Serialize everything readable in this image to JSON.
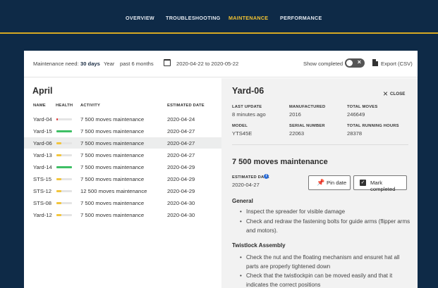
{
  "nav": {
    "tabs": [
      {
        "label": "OVERVIEW",
        "active": false
      },
      {
        "label": "TROUBLESHOOTING",
        "active": false
      },
      {
        "label": "MAINTENANCE",
        "active": true
      },
      {
        "label": "PERFORMANCE",
        "active": false
      }
    ]
  },
  "filter": {
    "need_label": "Maintenance need:",
    "days": "30 days",
    "year": "Year",
    "past": "past 6 months",
    "date_range": "2020-04-22 to 2020-05-22",
    "show_completed": "Show completed",
    "show_completed_on": false,
    "export": "Export (CSV)"
  },
  "list": {
    "month": "April",
    "columns": [
      "NAME",
      "HEALTH",
      "ACTIVITY",
      "ESTIMATED DATE"
    ],
    "rows": [
      {
        "name": "Yard-04",
        "health": 0.08,
        "health_color": "#e03131",
        "activity": "7 500 moves maintenance",
        "date": "2020-04-24",
        "selected": false
      },
      {
        "name": "Yard-15",
        "health": 1.0,
        "health_color": "#3ebf65",
        "activity": "7 500 moves maintenance",
        "date": "2020-04-27",
        "selected": false
      },
      {
        "name": "Yard-06",
        "health": 0.3,
        "health_color": "#f3c53c",
        "activity": "7 500 moves maintenance",
        "date": "2020-04-27",
        "selected": true
      },
      {
        "name": "Yard-13",
        "health": 0.3,
        "health_color": "#f3c53c",
        "activity": "7 500 moves maintenance",
        "date": "2020-04-27",
        "selected": false
      },
      {
        "name": "Yard-14",
        "health": 1.0,
        "health_color": "#3ebf65",
        "activity": "7 500 moves maintenance",
        "date": "2020-04-29",
        "selected": false
      },
      {
        "name": "STS-15",
        "health": 0.3,
        "health_color": "#f3c53c",
        "activity": "7 500 moves maintenance",
        "date": "2020-04-29",
        "selected": false
      },
      {
        "name": "STS-12",
        "health": 0.3,
        "health_color": "#f3c53c",
        "activity": "12 500 moves maintenance",
        "date": "2020-04-29",
        "selected": false
      },
      {
        "name": "STS-08",
        "health": 0.3,
        "health_color": "#f3c53c",
        "activity": "7 500 moves maintenance",
        "date": "2020-04-30",
        "selected": false
      },
      {
        "name": "Yard-12",
        "health": 0.3,
        "health_color": "#f3c53c",
        "activity": "7 500 moves maintenance",
        "date": "2020-04-30",
        "selected": false
      }
    ]
  },
  "detail": {
    "title": "Yard-06",
    "close": "CLOSE",
    "fields": [
      {
        "label": "LAST UPDATE",
        "value": "8 minutes ago"
      },
      {
        "label": "MANUFACTURED",
        "value": "2016"
      },
      {
        "label": "TOTAL MOVES",
        "value": "246649"
      },
      {
        "label": "MODEL",
        "value": "YTS45E"
      },
      {
        "label": "SERIAL NUMBER",
        "value": "22063"
      },
      {
        "label": "TOTAL RUNNING HOURS",
        "value": "28378"
      }
    ],
    "maintenance_title": "7 500 moves maintenance",
    "est_label": "ESTIMATED DATE",
    "est_value": "2020-04-27",
    "pin_date": "Pin date",
    "mark_completed": "Mark completed",
    "sections": [
      {
        "title": "General",
        "items": [
          "Inspect the spreader for visible damage",
          "Check and redraw the fastening bolts for guide arms (flipper arms and motors)."
        ]
      },
      {
        "title": "Twistlock Assembly",
        "items": [
          "Check the nut and the floating mechanism and ensuret hat all parts are properly tightened down",
          "Check that the twistlockpin can be moved easily and that it indicates the correct positions"
        ]
      }
    ]
  }
}
